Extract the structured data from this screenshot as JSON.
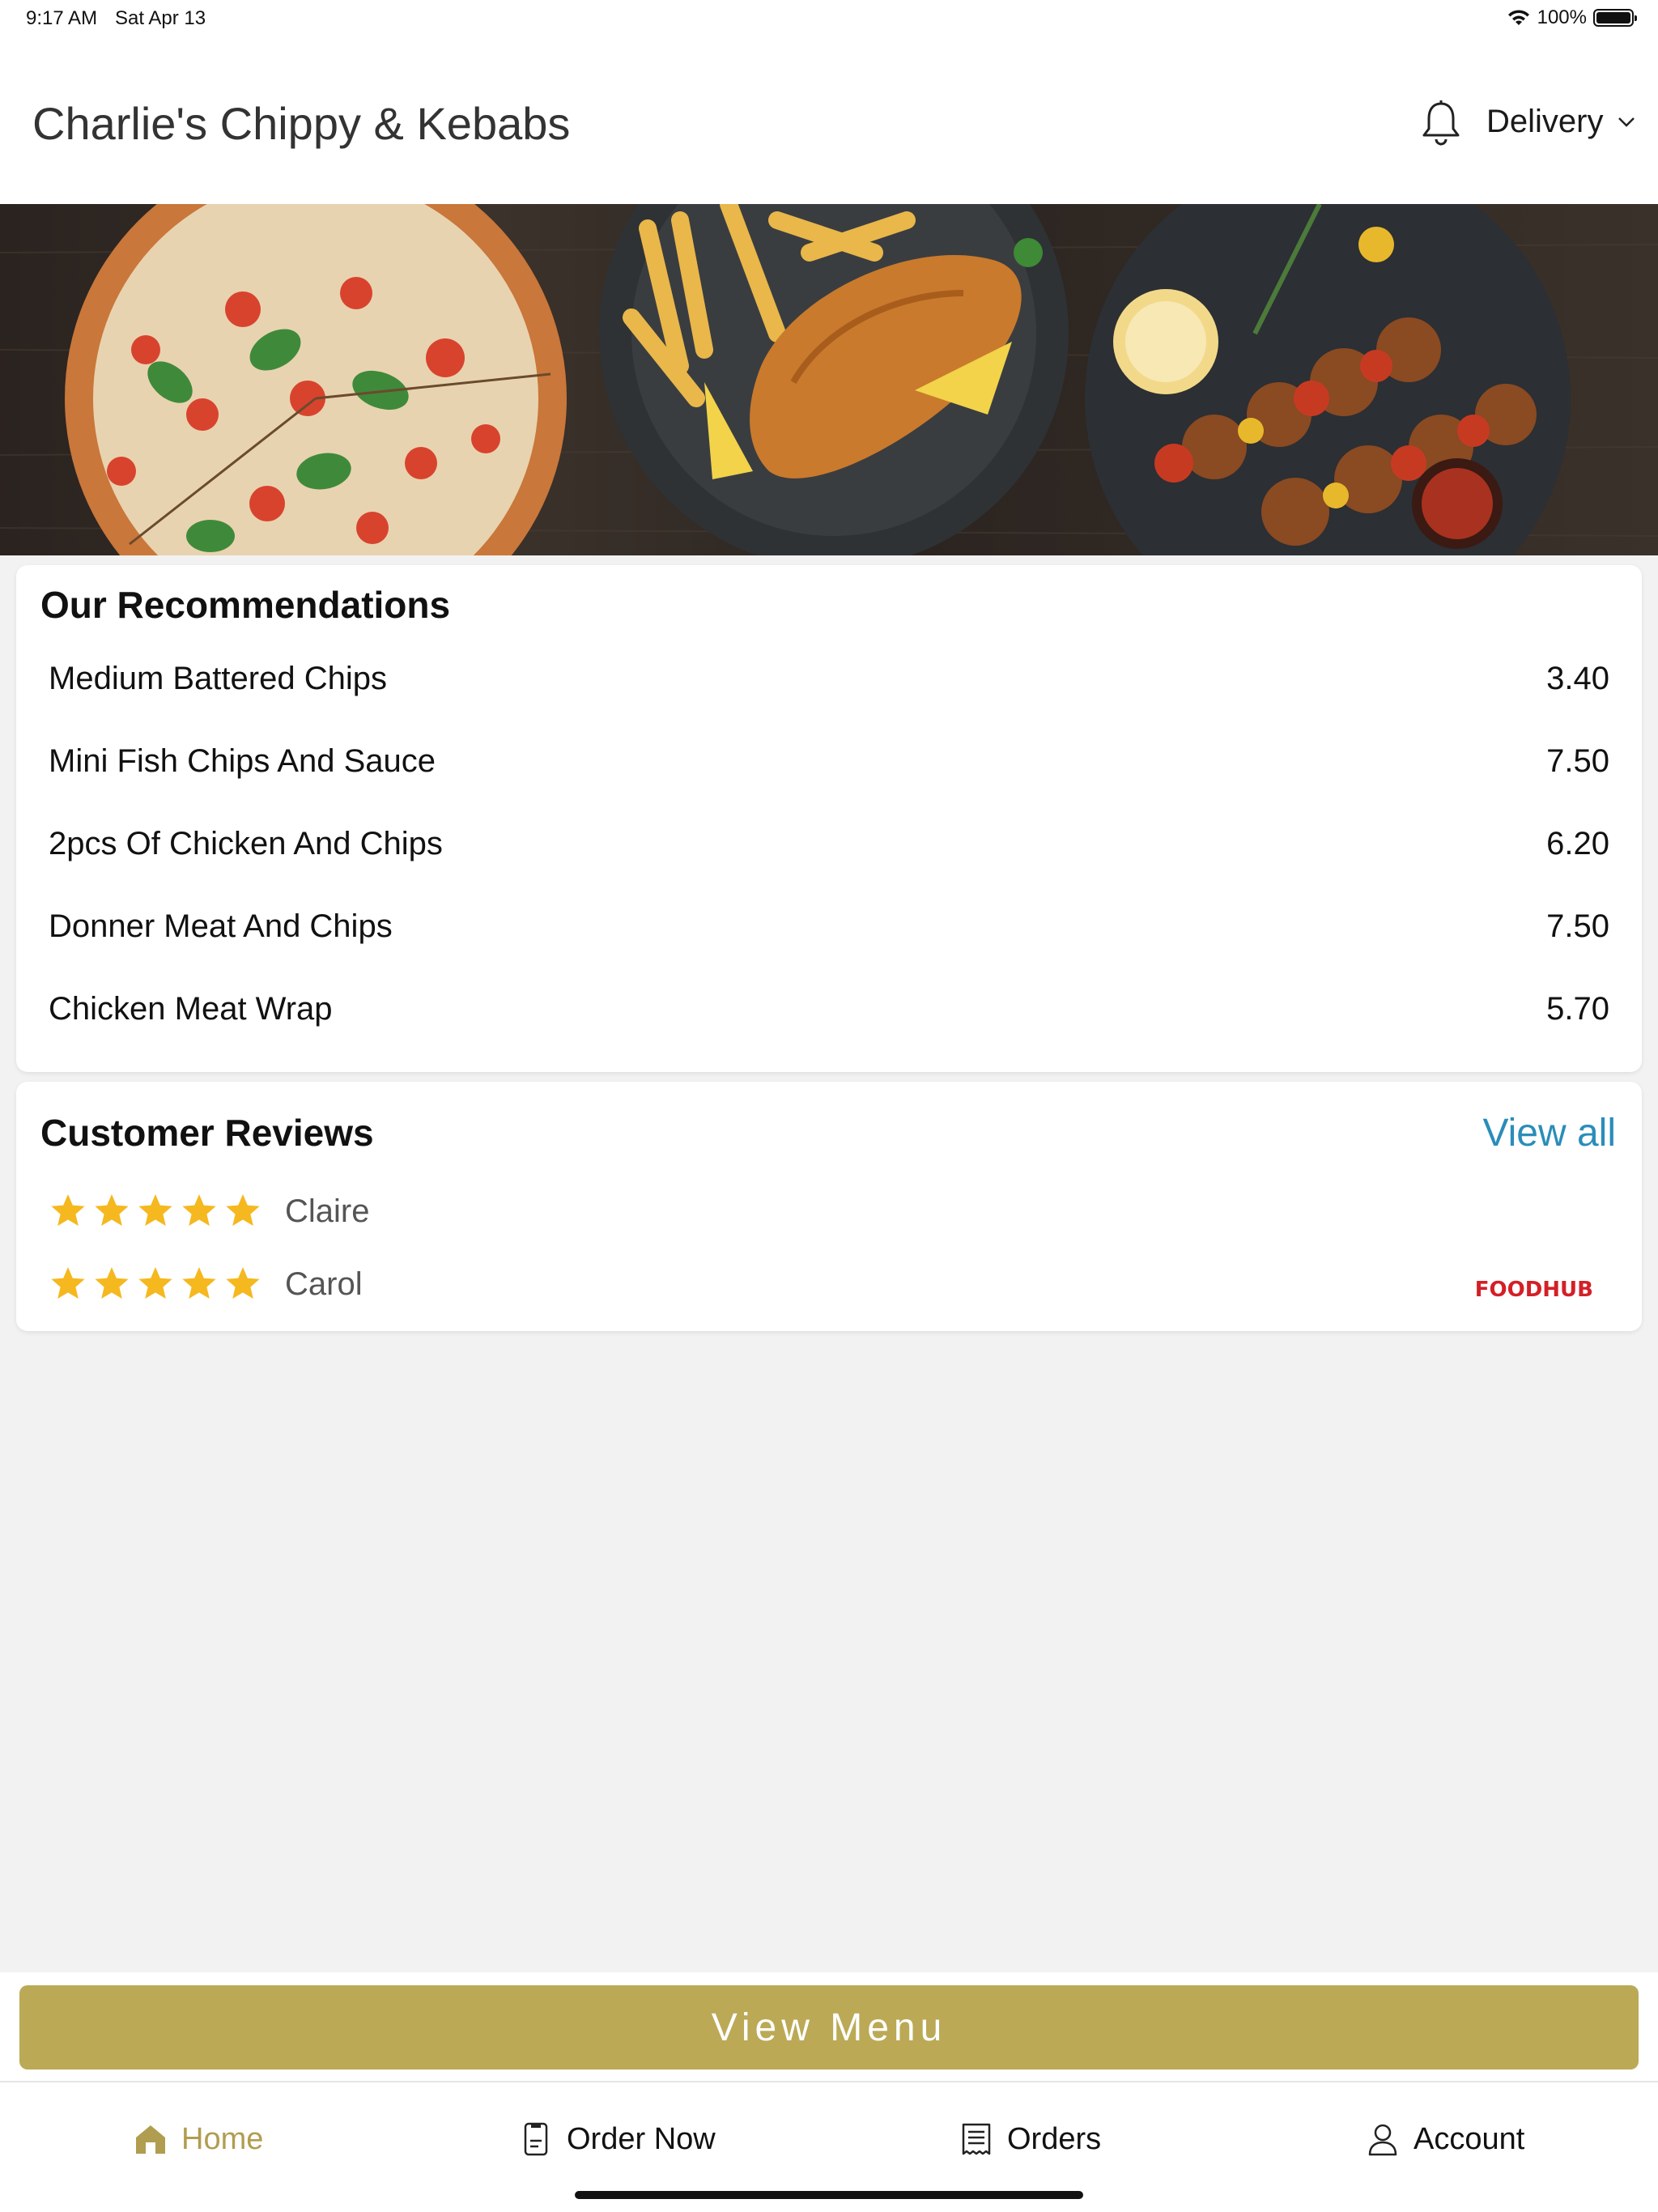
{
  "status_bar": {
    "time": "9:17 AM",
    "date": "Sat Apr 13",
    "battery": "100%"
  },
  "header": {
    "title": "Charlie's Chippy & Kebabs",
    "order_mode": "Delivery"
  },
  "recommendations": {
    "title": "Our Recommendations",
    "items": [
      {
        "name": "Medium Battered Chips",
        "price": "3.40"
      },
      {
        "name": "Mini Fish Chips And Sauce",
        "price": "7.50"
      },
      {
        "name": "2pcs Of Chicken And Chips",
        "price": "6.20"
      },
      {
        "name": "Donner Meat And Chips",
        "price": "7.50"
      },
      {
        "name": "Chicken Meat Wrap",
        "price": "5.70"
      }
    ]
  },
  "reviews": {
    "title": "Customer Reviews",
    "view_all_label": "View all",
    "items": [
      {
        "name": "Claire",
        "rating": 5
      },
      {
        "name": "Carol",
        "rating": 5
      }
    ],
    "brand_logo_text": "FOODHUB"
  },
  "view_menu_label": "View Menu",
  "tabs": [
    {
      "label": "Home",
      "icon": "home-icon",
      "active": true
    },
    {
      "label": "Order Now",
      "icon": "order-now-icon",
      "active": false
    },
    {
      "label": "Orders",
      "icon": "receipt-icon",
      "active": false
    },
    {
      "label": "Account",
      "icon": "user-icon",
      "active": false
    }
  ],
  "colors": {
    "accent": "#bba956",
    "link": "#2a8db9",
    "star": "#f5b81e",
    "brand_red": "#d41f27"
  }
}
